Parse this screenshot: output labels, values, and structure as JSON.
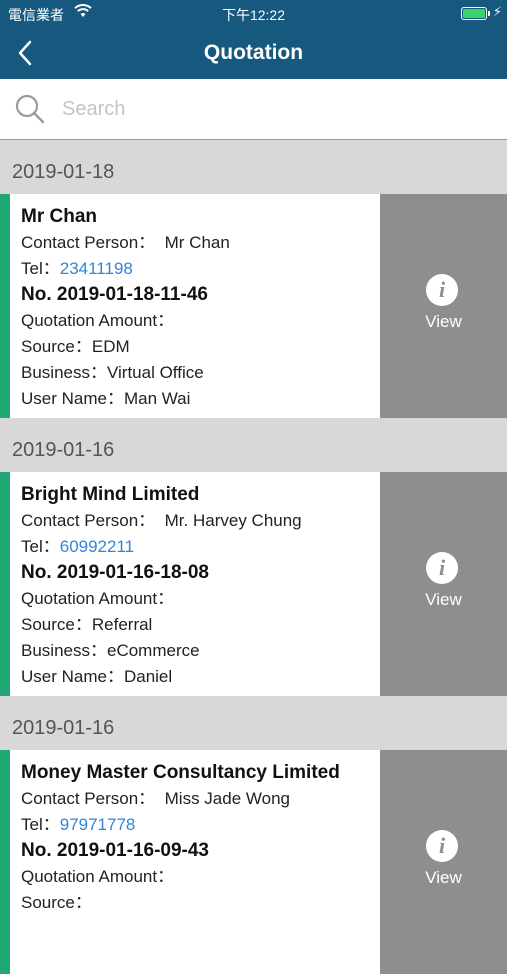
{
  "status_bar": {
    "carrier": "電信業者",
    "time": "下午12:22",
    "icons": [
      "wifi-icon",
      "battery-icon",
      "charging-icon"
    ]
  },
  "nav": {
    "title": "Quotation",
    "back_icon": "chevron-left-icon"
  },
  "search": {
    "placeholder": "Search",
    "value": "",
    "icon": "search-icon"
  },
  "colors": {
    "header_bg": "#17587f",
    "accent_bar": "#1fa873",
    "phone_link": "#2f86d9",
    "view_button_bg": "#8e8e8e",
    "section_bg": "#d8d8d8"
  },
  "groups": [
    {
      "date": "2019-01-18",
      "company": "Mr Chan",
      "contact_label": "Contact Person：",
      "contact": "Mr Chan",
      "tel_label": "Tel：",
      "tel": "23411198",
      "quotation_no": "No. 2019-01-18-11-46",
      "amount_label": "Quotation Amount：",
      "amount": "",
      "source_label": "Source：",
      "source": "EDM",
      "business_label": "Business：",
      "business": "Virtual Office",
      "user_label": "User Name：",
      "user": "Man Wai",
      "view_label": "View"
    },
    {
      "date": "2019-01-16",
      "company": "Bright Mind Limited",
      "contact_label": "Contact Person：",
      "contact": "Mr. Harvey Chung",
      "tel_label": "Tel：",
      "tel": "60992211",
      "quotation_no": "No. 2019-01-16-18-08",
      "amount_label": "Quotation Amount：",
      "amount": "",
      "source_label": "Source：",
      "source": "Referral",
      "business_label": "Business：",
      "business": "eCommerce",
      "user_label": "User Name：",
      "user": "Daniel",
      "view_label": "View"
    },
    {
      "date": "2019-01-16",
      "company": "Money Master Consultancy Limited",
      "contact_label": "Contact Person：",
      "contact": "Miss Jade Wong",
      "tel_label": "Tel：",
      "tel": "97971778",
      "quotation_no": "No. 2019-01-16-09-43",
      "amount_label": "Quotation Amount：",
      "amount": "",
      "source_label": "Source：",
      "source": "",
      "business_label": "Business：",
      "business": "",
      "user_label": "User Name：",
      "user": "",
      "view_label": "View"
    }
  ]
}
